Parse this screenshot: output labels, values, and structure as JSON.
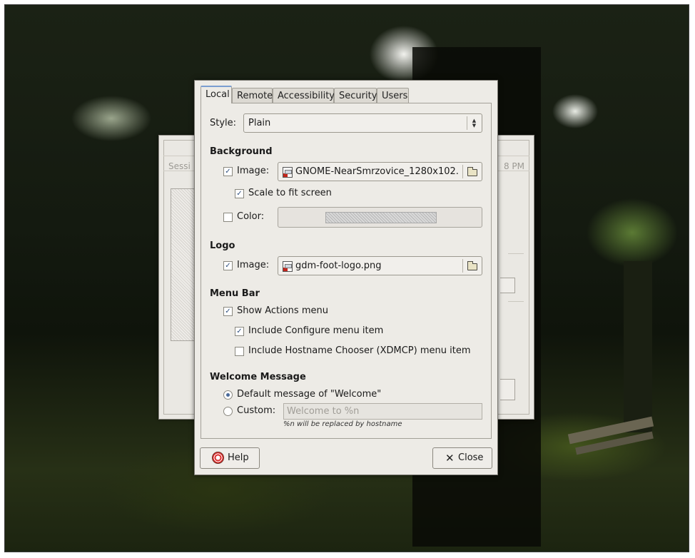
{
  "tabs": [
    "Local",
    "Remote",
    "Accessibility",
    "Security",
    "Users"
  ],
  "style": {
    "label": "Style:",
    "value": "Plain"
  },
  "background": {
    "heading": "Background",
    "image_label": "Image:",
    "image_checked": true,
    "image_file": "GNOME-NearSmrzovice_1280x102...",
    "scale_label": "Scale to fit screen",
    "scale_checked": true,
    "color_label": "Color:",
    "color_checked": false
  },
  "logo": {
    "heading": "Logo",
    "image_label": "Image:",
    "image_checked": true,
    "image_file": "gdm-foot-logo.png"
  },
  "menubar": {
    "heading": "Menu Bar",
    "show_actions": "Show Actions menu",
    "show_actions_checked": true,
    "include_configure": "Include Configure menu item",
    "include_configure_checked": true,
    "include_hostname": "Include Hostname Chooser (XDMCP) menu item",
    "include_hostname_checked": false
  },
  "welcome": {
    "heading": "Welcome Message",
    "default_label": "Default message of \"Welcome\"",
    "custom_label": "Custom:",
    "selected": "default",
    "custom_placeholder": "Welcome to %n",
    "hint": "%n will be replaced by hostname"
  },
  "buttons": {
    "help": "Help",
    "close": "Close"
  },
  "back_window": {
    "label": "Sessi",
    "time": "8 PM"
  }
}
